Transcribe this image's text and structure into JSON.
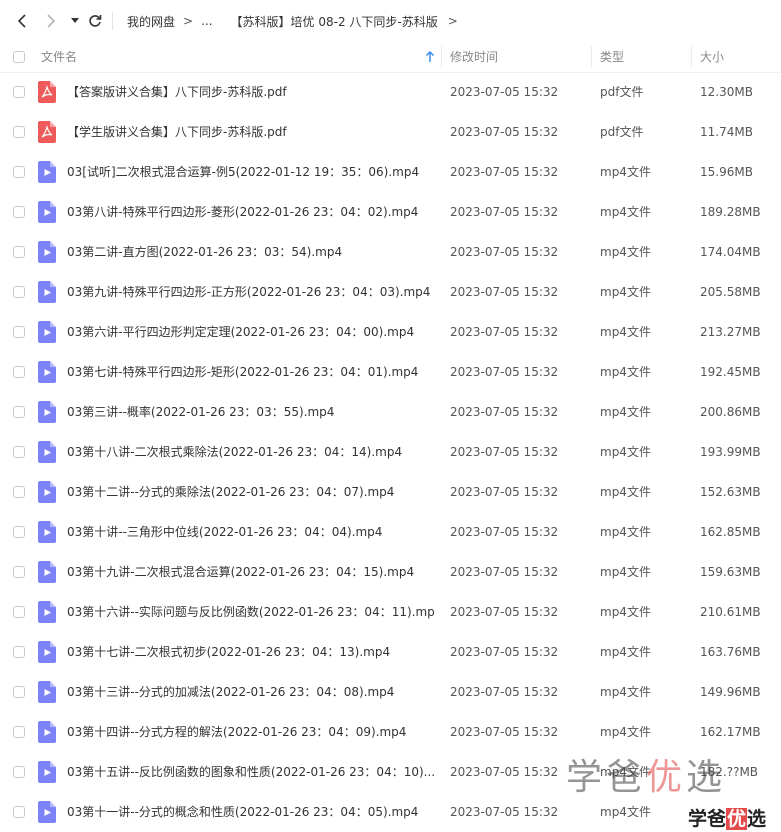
{
  "breadcrumbs": [
    "我的网盘",
    "...",
    "【苏科版】培优 08-2 八下同步-苏科版"
  ],
  "columns": {
    "name": "文件名",
    "mtime": "修改时间",
    "type": "类型",
    "size": "大小"
  },
  "files": [
    {
      "name": "【答案版讲义合集】八下同步-苏科版.pdf",
      "mtime": "2023-07-05 15:32",
      "type": "pdf文件",
      "size": "12.30MB",
      "icon": "pdf-icon"
    },
    {
      "name": "【学生版讲义合集】八下同步-苏科版.pdf",
      "mtime": "2023-07-05 15:32",
      "type": "pdf文件",
      "size": "11.74MB",
      "icon": "pdf-icon"
    },
    {
      "name": "03[试听]二次根式混合运算-例5(2022-01-12 19：35：06).mp4",
      "mtime": "2023-07-05 15:32",
      "type": "mp4文件",
      "size": "15.96MB",
      "icon": "video-icon"
    },
    {
      "name": "03第八讲-特殊平行四边形-菱形(2022-01-26 23：04：02).mp4",
      "mtime": "2023-07-05 15:32",
      "type": "mp4文件",
      "size": "189.28MB",
      "icon": "video-icon"
    },
    {
      "name": "03第二讲-直方图(2022-01-26 23：03：54).mp4",
      "mtime": "2023-07-05 15:32",
      "type": "mp4文件",
      "size": "174.04MB",
      "icon": "video-icon"
    },
    {
      "name": "03第九讲-特殊平行四边形-正方形(2022-01-26 23：04：03).mp4",
      "mtime": "2023-07-05 15:32",
      "type": "mp4文件",
      "size": "205.58MB",
      "icon": "video-icon"
    },
    {
      "name": "03第六讲-平行四边形判定定理(2022-01-26 23：04：00).mp4",
      "mtime": "2023-07-05 15:32",
      "type": "mp4文件",
      "size": "213.27MB",
      "icon": "video-icon"
    },
    {
      "name": "03第七讲-特殊平行四边形-矩形(2022-01-26 23：04：01).mp4",
      "mtime": "2023-07-05 15:32",
      "type": "mp4文件",
      "size": "192.45MB",
      "icon": "video-icon"
    },
    {
      "name": "03第三讲--概率(2022-01-26 23：03：55).mp4",
      "mtime": "2023-07-05 15:32",
      "type": "mp4文件",
      "size": "200.86MB",
      "icon": "video-icon"
    },
    {
      "name": "03第十八讲-二次根式乘除法(2022-01-26 23：04：14).mp4",
      "mtime": "2023-07-05 15:32",
      "type": "mp4文件",
      "size": "193.99MB",
      "icon": "video-icon"
    },
    {
      "name": "03第十二讲--分式的乘除法(2022-01-26 23：04：07).mp4",
      "mtime": "2023-07-05 15:32",
      "type": "mp4文件",
      "size": "152.63MB",
      "icon": "video-icon"
    },
    {
      "name": "03第十讲--三角形中位线(2022-01-26 23：04：04).mp4",
      "mtime": "2023-07-05 15:32",
      "type": "mp4文件",
      "size": "162.85MB",
      "icon": "video-icon"
    },
    {
      "name": "03第十九讲-二次根式混合运算(2022-01-26 23：04：15).mp4",
      "mtime": "2023-07-05 15:32",
      "type": "mp4文件",
      "size": "159.63MB",
      "icon": "video-icon"
    },
    {
      "name": "03第十六讲--实际问题与反比例函数(2022-01-26 23：04：11).mp4",
      "mtime": "2023-07-05 15:32",
      "type": "mp4文件",
      "size": "210.61MB",
      "icon": "video-icon"
    },
    {
      "name": "03第十七讲-二次根式初步(2022-01-26 23：04：13).mp4",
      "mtime": "2023-07-05 15:32",
      "type": "mp4文件",
      "size": "163.76MB",
      "icon": "video-icon"
    },
    {
      "name": "03第十三讲--分式的加减法(2022-01-26 23：04：08).mp4",
      "mtime": "2023-07-05 15:32",
      "type": "mp4文件",
      "size": "149.96MB",
      "icon": "video-icon"
    },
    {
      "name": "03第十四讲--分式方程的解法(2022-01-26 23：04：09).mp4",
      "mtime": "2023-07-05 15:32",
      "type": "mp4文件",
      "size": "162.17MB",
      "icon": "video-icon"
    },
    {
      "name": "03第十五讲--反比例函数的图象和性质(2022-01-26 23：04：10)....",
      "mtime": "2023-07-05 15:32",
      "type": "mp4文件",
      "size": "182.??MB",
      "icon": "video-icon"
    },
    {
      "name": "03第十一讲--分式的概念和性质(2022-01-26 23：04：05).mp4",
      "mtime": "2023-07-05 15:32",
      "type": "mp4文件",
      "size": "",
      "icon": "video-icon"
    }
  ],
  "watermark": {
    "large_a": "学爸",
    "large_b": "优",
    "large_c": "选",
    "small_a": "学爸",
    "small_b": "优",
    "small_c": "选"
  },
  "colors": {
    "pdf": "#ef5b5b",
    "video": "#7b83f7",
    "accent": "#3d8cf0"
  }
}
